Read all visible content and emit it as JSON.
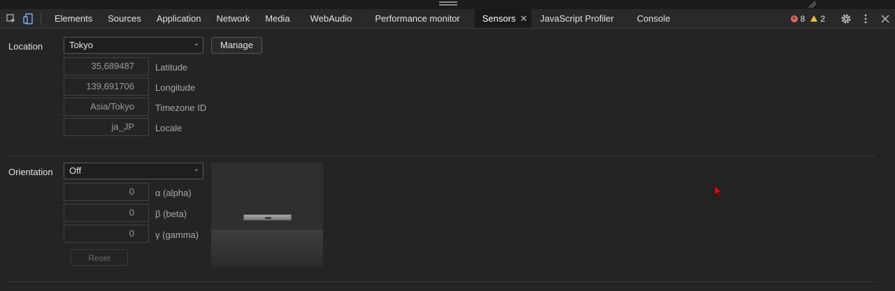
{
  "toolbar": {
    "tabs": [
      {
        "label": "Elements"
      },
      {
        "label": "Sources"
      },
      {
        "label": "Application"
      },
      {
        "label": "Network"
      },
      {
        "label": "Media"
      },
      {
        "label": "WebAudio"
      },
      {
        "label": "Performance monitor"
      },
      {
        "label": "Sensors",
        "active": true
      },
      {
        "label": "JavaScript Profiler"
      },
      {
        "label": "Console"
      }
    ],
    "error_count": "8",
    "warning_count": "2",
    "close_tab_glyph": "✕"
  },
  "location": {
    "label": "Location",
    "selected": "Tokyo",
    "manage_label": "Manage",
    "fields": [
      {
        "value": "35,689487",
        "label": "Latitude"
      },
      {
        "value": "139,691706",
        "label": "Longitude"
      },
      {
        "value": "Asia/Tokyo",
        "label": "Timezone ID"
      },
      {
        "value": "ja_JP",
        "label": "Locale"
      }
    ]
  },
  "orientation": {
    "label": "Orientation",
    "selected": "Off",
    "fields": [
      {
        "value": "0",
        "label": "α (alpha)"
      },
      {
        "value": "0",
        "label": "β (beta)"
      },
      {
        "value": "0",
        "label": "γ (gamma)"
      }
    ],
    "reset_label": "Reset"
  },
  "colors": {
    "error": "#e46962",
    "warning": "#f2bb3d",
    "cursor": "#d01010"
  }
}
